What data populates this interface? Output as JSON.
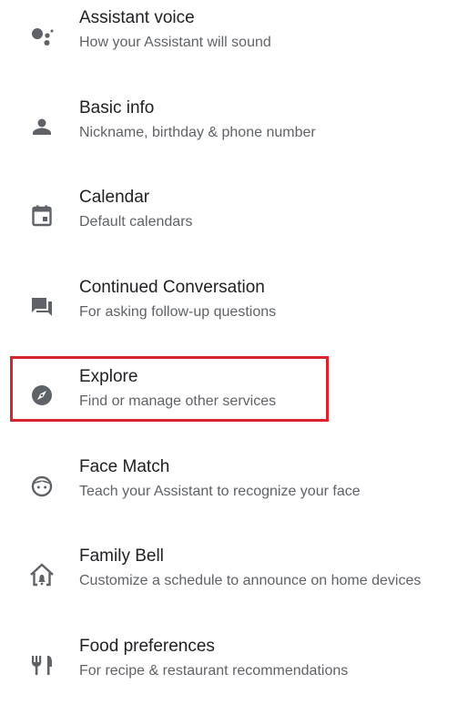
{
  "settings": {
    "items": [
      {
        "icon": "assistant-voice-icon",
        "title": "Assistant voice",
        "subtitle": "How your Assistant will sound"
      },
      {
        "icon": "person-icon",
        "title": "Basic info",
        "subtitle": "Nickname, birthday & phone number"
      },
      {
        "icon": "calendar-icon",
        "title": "Calendar",
        "subtitle": "Default calendars"
      },
      {
        "icon": "chat-bubbles-icon",
        "title": "Continued Conversation",
        "subtitle": "For asking follow-up questions"
      },
      {
        "icon": "compass-icon",
        "title": "Explore",
        "subtitle": "Find or manage other services"
      },
      {
        "icon": "face-icon",
        "title": "Face Match",
        "subtitle": "Teach your Assistant to recognize your face"
      },
      {
        "icon": "home-bell-icon",
        "title": "Family Bell",
        "subtitle": "Customize a schedule to announce on home devices"
      },
      {
        "icon": "fork-knife-icon",
        "title": "Food preferences",
        "subtitle": "For recipe & restaurant recommendations"
      }
    ]
  },
  "highlight": {
    "target": "Explore",
    "color": "#d9232d"
  },
  "colors": {
    "icon": "#5f6368",
    "title": "#202124",
    "subtitle": "#5f6368"
  }
}
